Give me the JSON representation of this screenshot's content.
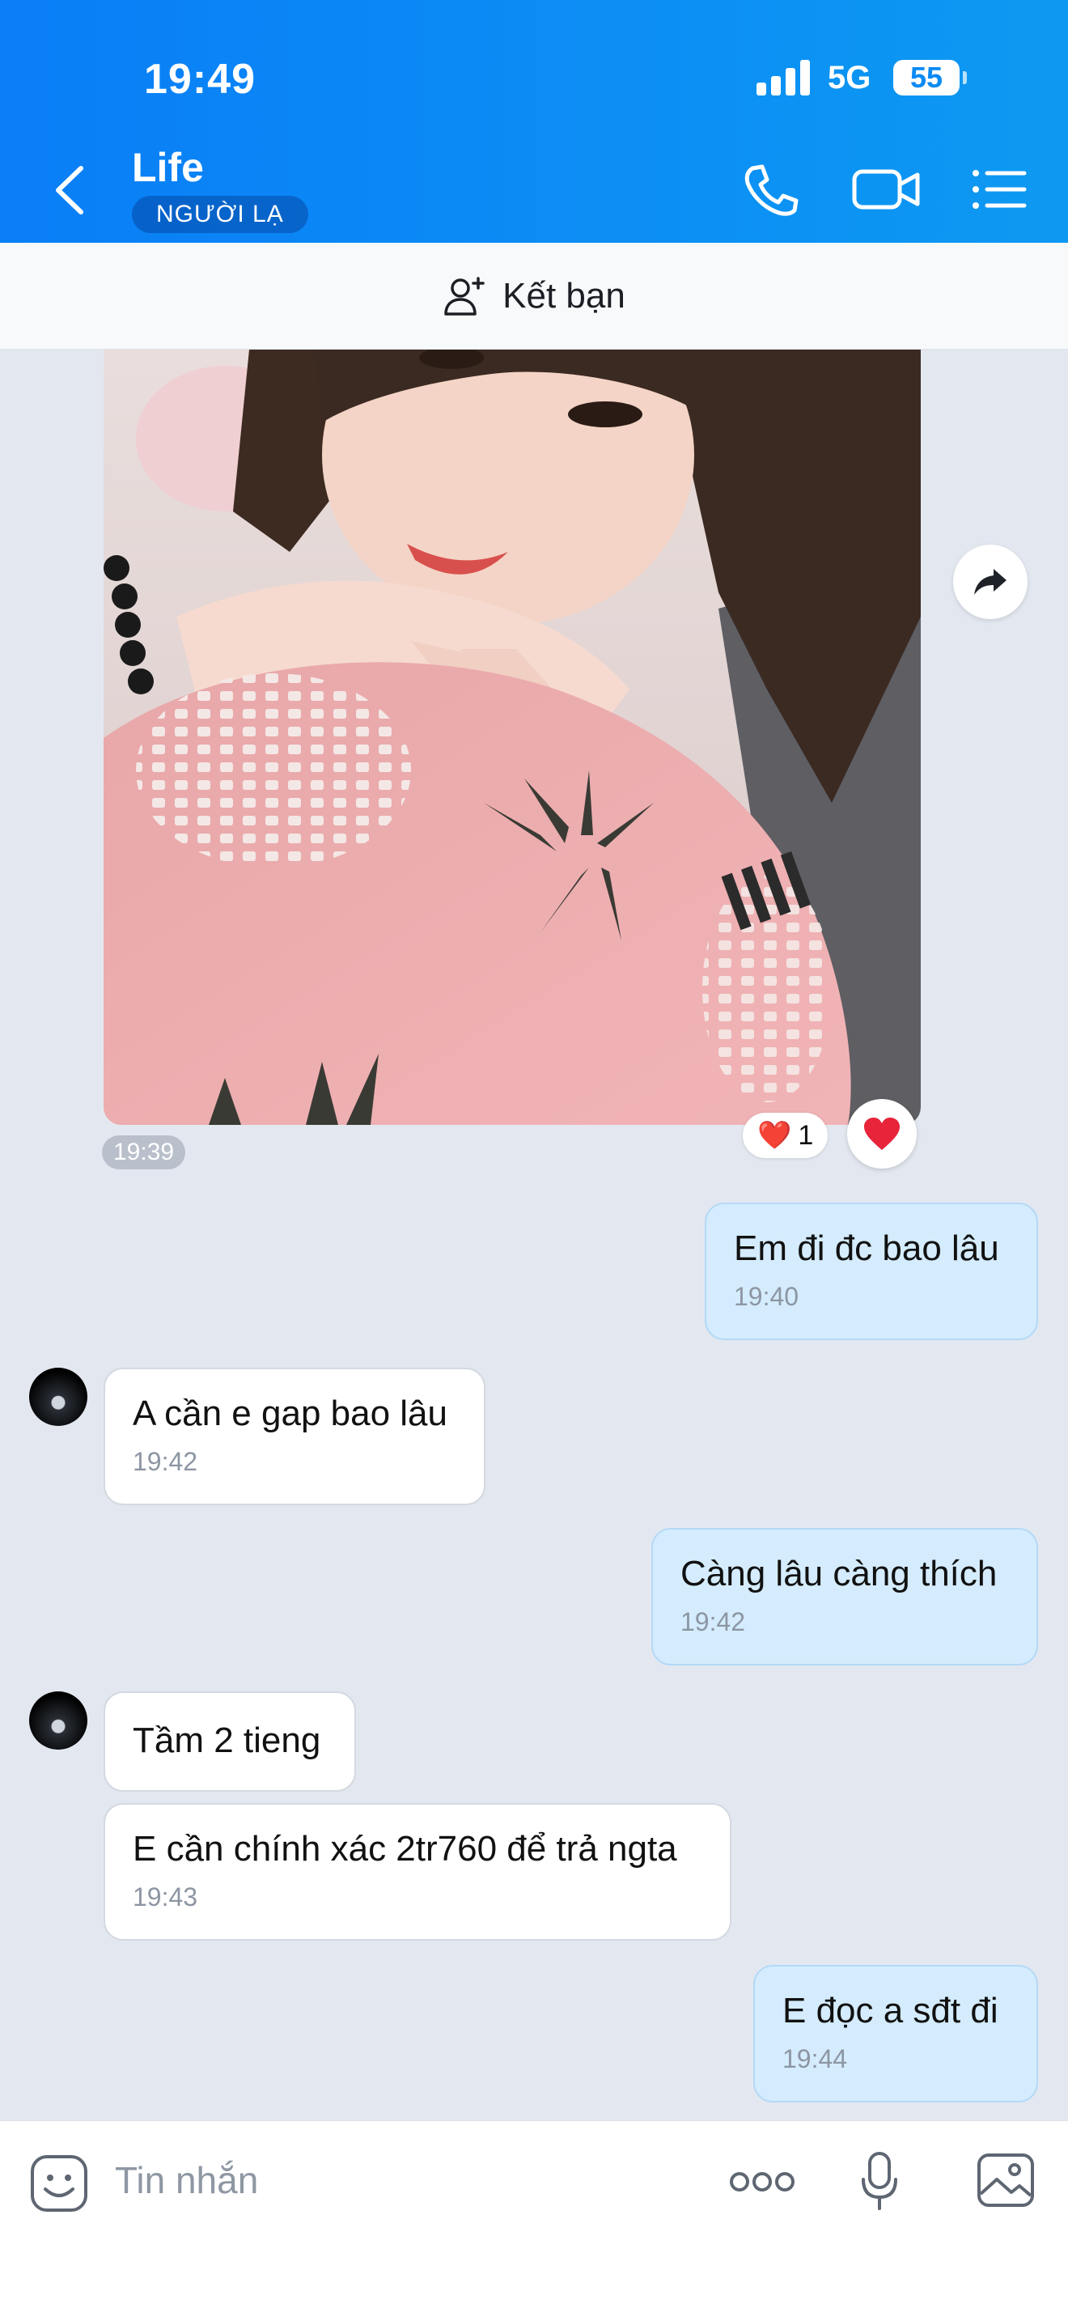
{
  "status_bar": {
    "time": "19:49",
    "network": "5G",
    "battery": "55"
  },
  "header": {
    "title": "Life",
    "badge": "NGƯỜI LẠ"
  },
  "add_friend": {
    "label": "Kết bạn"
  },
  "photo_message": {
    "time": "19:39",
    "reaction_emoji": "❤️",
    "reaction_count": "1"
  },
  "messages": [
    {
      "text": "Em đi đc bao lâu",
      "time": "19:40"
    },
    {
      "text": "A cần e gap bao lâu",
      "time": "19:42"
    },
    {
      "text": "Càng lâu càng thích",
      "time": "19:42"
    },
    {
      "text": "Tầm 2 tieng"
    },
    {
      "text": "E cần chính xác 2tr760 để trả ngta",
      "time": "19:43"
    },
    {
      "text": "E đọc a sđt đi",
      "time": "19:44"
    }
  ],
  "composer": {
    "placeholder": "Tin nhắn"
  }
}
